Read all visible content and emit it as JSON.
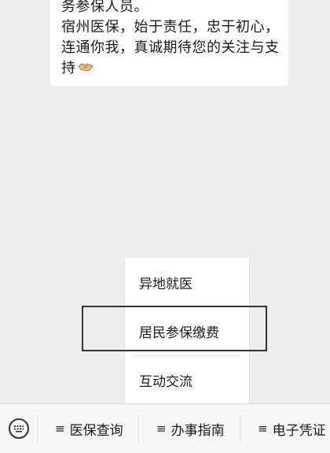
{
  "chat": {
    "message_lines": [
      "务参保人员。",
      "宿州医保，始于责任，忠于初心，",
      "连通你我，真诚期待您的关注与支",
      "持"
    ],
    "emoji_icon": "handshake-icon"
  },
  "submenu": {
    "items": [
      {
        "label": "异地就医"
      },
      {
        "label": "居民参保缴费"
      },
      {
        "label": "互动交流"
      }
    ],
    "highlighted_index": 1
  },
  "bottom_menu": {
    "keyboard_icon": "keyboard-icon",
    "menu_glyph": "≡",
    "items": [
      {
        "label": "医保查询"
      },
      {
        "label": "办事指南"
      },
      {
        "label": "电子凭证"
      }
    ]
  }
}
